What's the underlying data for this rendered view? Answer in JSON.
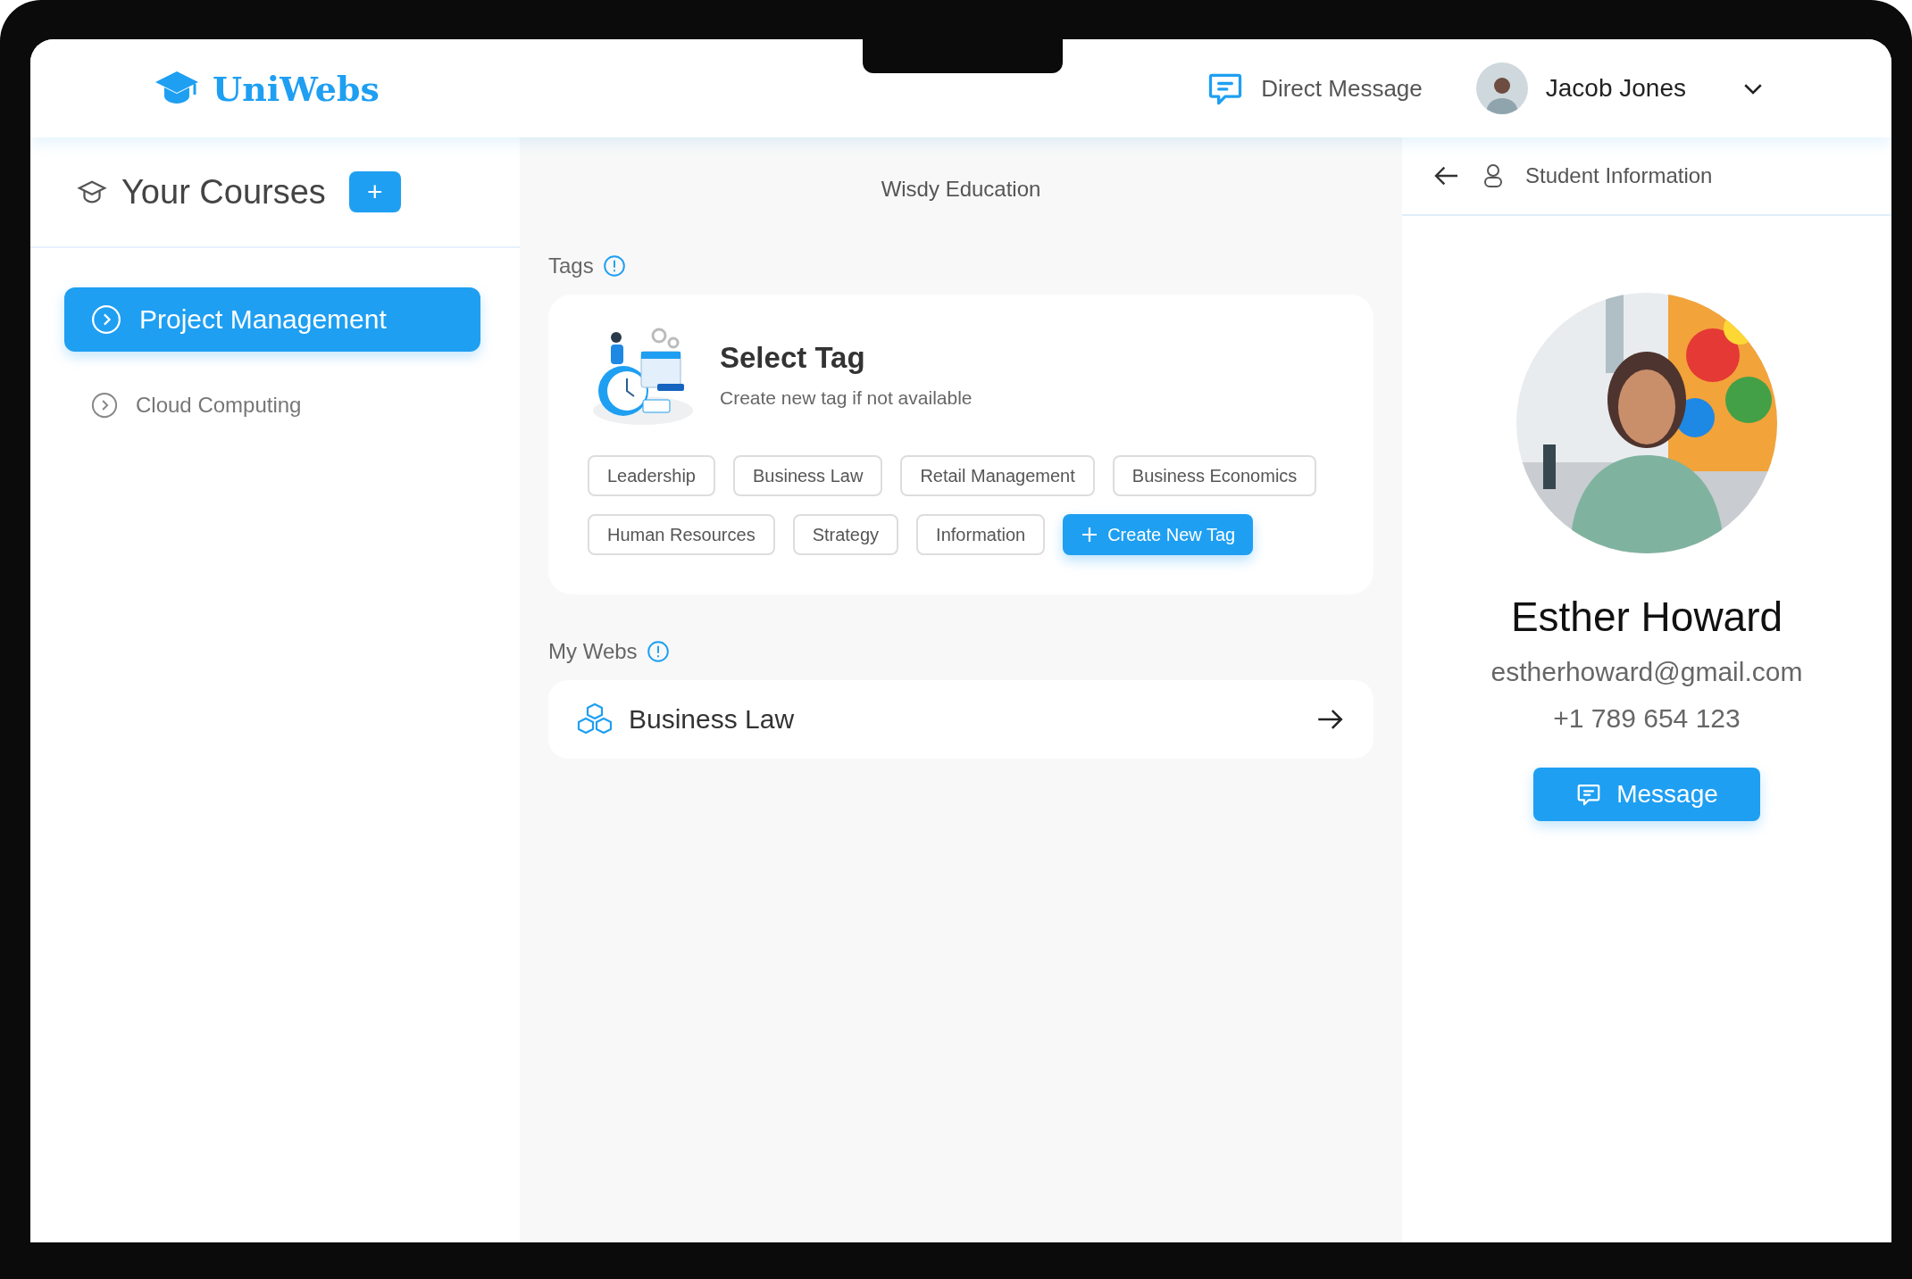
{
  "header": {
    "logo": "UniWebs",
    "direct_message": "Direct Message",
    "user": {
      "name": "Jacob Jones"
    }
  },
  "sidebar": {
    "title": "Your Courses",
    "add_button": "+",
    "courses": [
      {
        "label": "Project Management",
        "selected": true
      },
      {
        "label": "Cloud Computing",
        "selected": false
      }
    ]
  },
  "main": {
    "title": "Wisdy Education",
    "tags_label": "Tags",
    "tag_card": {
      "title": "Select Tag",
      "subtitle": "Create new tag if not available",
      "tags": [
        "Leadership",
        "Business Law",
        "Retail Management",
        "Business Economics",
        "Human Resources",
        "Strategy",
        "Information"
      ],
      "create_button": "Create New Tag"
    },
    "webs_label": "My Webs",
    "webs": [
      {
        "label": "Business Law"
      }
    ]
  },
  "student": {
    "title": "Student Information",
    "name": "Esther Howard",
    "email": "estherhoward@gmail.com",
    "phone": "+1 789 654 123",
    "message_button": "Message"
  }
}
